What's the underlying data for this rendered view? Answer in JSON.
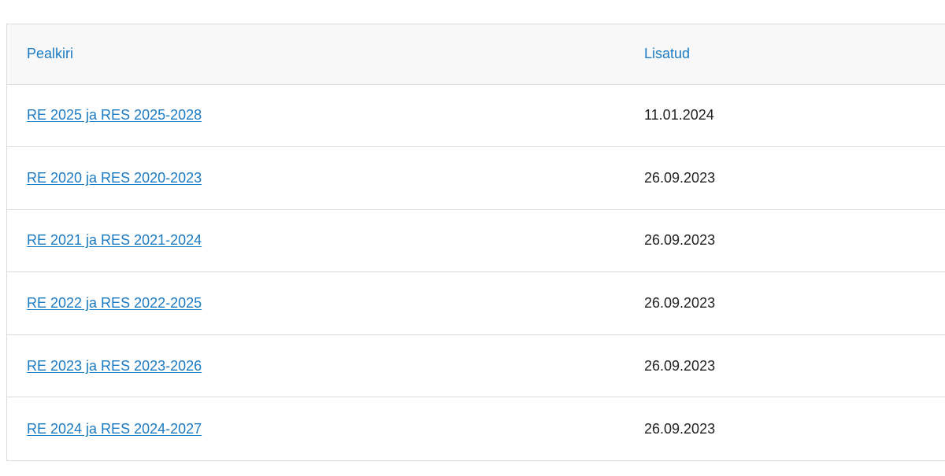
{
  "table": {
    "headers": {
      "title": "Pealkiri",
      "date": "Lisatud"
    },
    "rows": [
      {
        "title": "RE 2025 ja RES 2025-2028",
        "date": "11.01.2024"
      },
      {
        "title": "RE 2020 ja RES 2020-2023",
        "date": "26.09.2023"
      },
      {
        "title": "RE 2021 ja RES 2021-2024",
        "date": "26.09.2023"
      },
      {
        "title": "RE 2022 ja RES 2022-2025",
        "date": "26.09.2023"
      },
      {
        "title": "RE 2023 ja RES 2023-2026",
        "date": "26.09.2023"
      },
      {
        "title": "RE 2024 ja RES 2024-2027",
        "date": "26.09.2023"
      }
    ]
  },
  "colors": {
    "link": "#1a7ac2",
    "header_bg": "#f8f8f8",
    "border": "#dcdcdc",
    "text": "#222222"
  }
}
